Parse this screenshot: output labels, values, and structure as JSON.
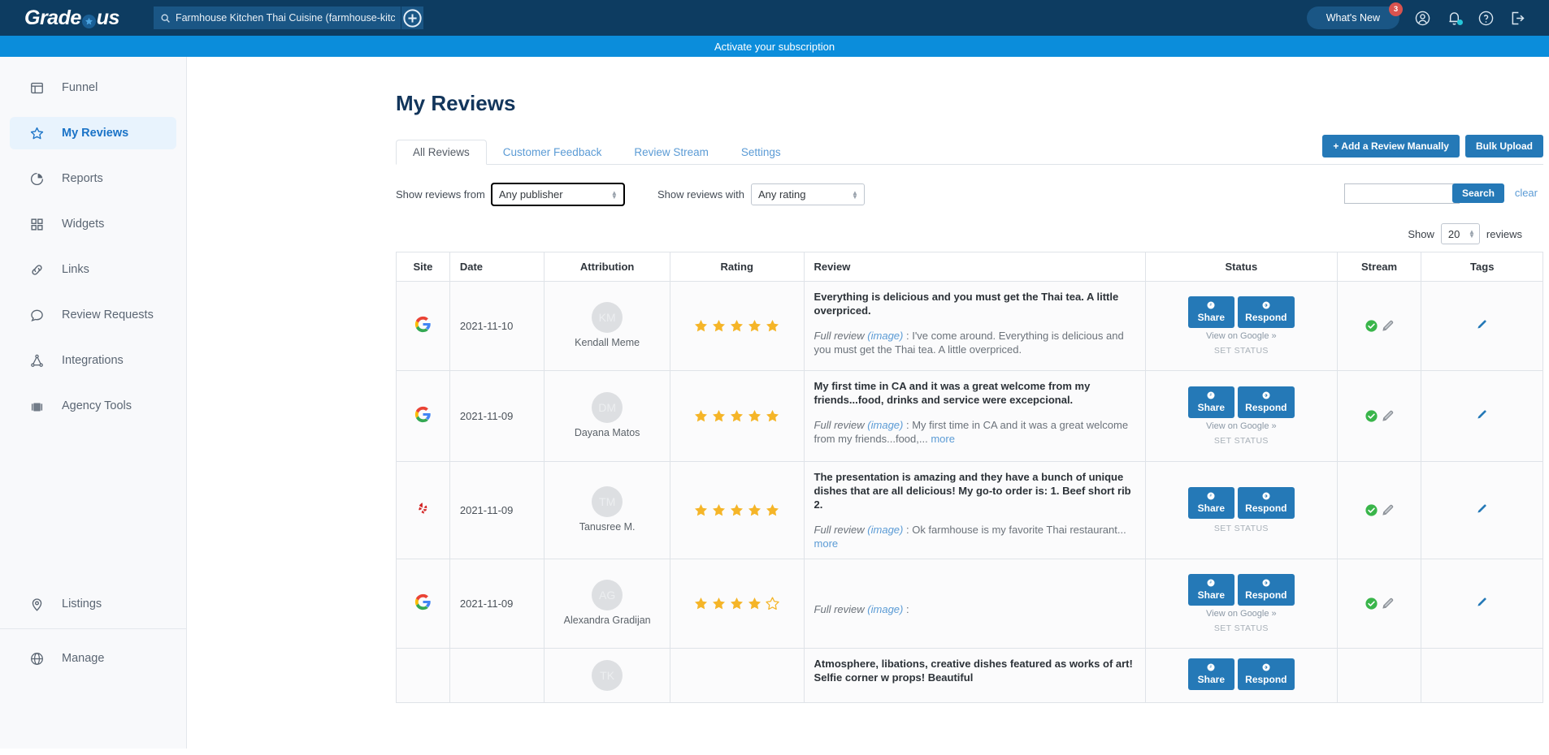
{
  "topbar": {
    "logo_text_left": "Grade",
    "logo_text_right": "us",
    "search_value": "Farmhouse Kitchen Thai Cuisine (farmhouse-kitc",
    "search_placeholder": "Search",
    "whats_new_label": "What's New",
    "whats_new_badge": "3"
  },
  "banner": {
    "text": "Activate your subscription"
  },
  "sidebar": {
    "items": [
      {
        "label": "Funnel",
        "icon": "funnel-icon",
        "active": false
      },
      {
        "label": "My Reviews",
        "icon": "star-icon",
        "active": true
      },
      {
        "label": "Reports",
        "icon": "pie-chart-icon",
        "active": false
      },
      {
        "label": "Widgets",
        "icon": "grid-icon",
        "active": false
      },
      {
        "label": "Links",
        "icon": "link-icon",
        "active": false
      },
      {
        "label": "Review Requests",
        "icon": "chat-bubble-icon",
        "active": false
      },
      {
        "label": "Integrations",
        "icon": "integrations-icon",
        "active": false
      },
      {
        "label": "Agency Tools",
        "icon": "briefcase-icon",
        "active": false
      }
    ],
    "bottom_items": [
      {
        "label": "Listings",
        "icon": "map-pin-icon"
      },
      {
        "label": "Manage",
        "icon": "globe-icon"
      }
    ]
  },
  "page": {
    "title": "My Reviews"
  },
  "tabs": [
    {
      "label": "All Reviews",
      "active": true
    },
    {
      "label": "Customer Feedback",
      "active": false
    },
    {
      "label": "Review Stream",
      "active": false
    },
    {
      "label": "Settings",
      "active": false
    }
  ],
  "header_buttons": {
    "add_review": "+ Add a Review Manually",
    "bulk_upload": "Bulk Upload"
  },
  "filters": {
    "publisher_label": "Show reviews from",
    "publisher_value": "Any publisher",
    "rating_label": "Show reviews with",
    "rating_value": "Any rating",
    "search_value": "",
    "search_button": "Search",
    "clear_link": "clear"
  },
  "pagination": {
    "show_label": "Show",
    "count": "20",
    "reviews_label": "reviews"
  },
  "table": {
    "columns": [
      "Site",
      "Date",
      "Attribution",
      "Rating",
      "Review",
      "Status",
      "Stream",
      "Tags"
    ],
    "rows": [
      {
        "site": "google-icon",
        "date": "2021-11-10",
        "initials": "KM",
        "name": "Kendall Meme",
        "rating": 5,
        "review_title": "Everything is delicious and you must get the Thai tea. A little overpriced.",
        "full_review_label": "Full review",
        "image_label": "(image)",
        "full_review_text": " : I've come around. Everything is delicious and you must get the Thai tea. A little overpriced.",
        "more_label": "",
        "share_label": "Share",
        "respond_label": "Respond",
        "view_link": "View on Google »",
        "set_status": "SET STATUS"
      },
      {
        "site": "google-icon",
        "date": "2021-11-09",
        "initials": "DM",
        "name": "Dayana Matos",
        "rating": 5,
        "review_title": "My first time in CA and it was a great welcome from my friends...food, drinks and service were excepcional.",
        "full_review_label": "Full review",
        "image_label": "(image)",
        "full_review_text": " : My first time in CA and it was a great welcome from my friends...food,... ",
        "more_label": "more",
        "share_label": "Share",
        "respond_label": "Respond",
        "view_link": "View on Google »",
        "set_status": "SET STATUS"
      },
      {
        "site": "yelp-icon",
        "date": "2021-11-09",
        "initials": "TM",
        "name": "Tanusree M.",
        "rating": 5,
        "review_title": "The presentation is amazing and they have a bunch of unique dishes that are all delicious! My go-to order is: 1. Beef short rib 2.",
        "full_review_label": "Full review",
        "image_label": "(image)",
        "full_review_text": " : Ok farmhouse is my favorite Thai restaurant... ",
        "more_label": "more",
        "share_label": "Share",
        "respond_label": "Respond",
        "view_link": "",
        "set_status": "SET STATUS"
      },
      {
        "site": "google-icon",
        "date": "2021-11-09",
        "initials": "AG",
        "name": "Alexandra Gradijan",
        "rating": 4,
        "review_title": "",
        "full_review_label": "Full review",
        "image_label": "(image)",
        "full_review_text": " :",
        "more_label": "",
        "share_label": "Share",
        "respond_label": "Respond",
        "view_link": "View on Google »",
        "set_status": "SET STATUS"
      },
      {
        "site": "",
        "date": "",
        "initials": "TK",
        "name": "",
        "rating": 0,
        "review_title": "Atmosphere, libations, creative dishes featured as works of art! Selfie corner w props! Beautiful",
        "full_review_label": "",
        "image_label": "",
        "full_review_text": "",
        "more_label": "",
        "share_label": "Share",
        "respond_label": "Respond",
        "view_link": "",
        "set_status": ""
      }
    ]
  },
  "colors": {
    "topbar": "#0d3c61",
    "banner": "#0b8ddb",
    "accent_blue": "#2579b7",
    "link_blue": "#5b9bd5",
    "star_gold": "#f5b528",
    "yelp_red": "#d32323",
    "check_green": "#39b54a"
  }
}
